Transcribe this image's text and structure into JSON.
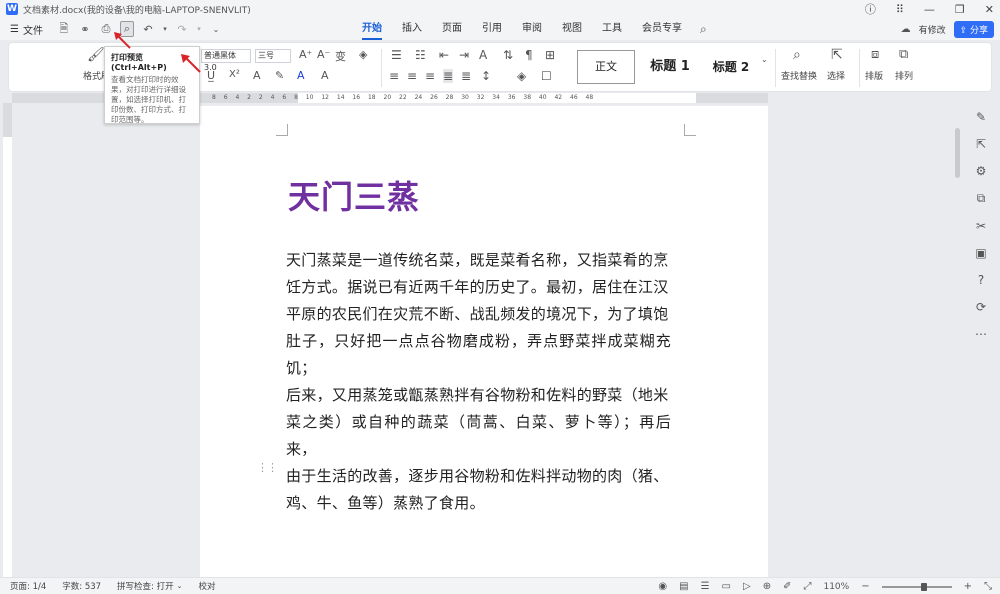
{
  "window": {
    "title": "文档素材.docx(我的设备\\我的电脑-LAPTOP-SNENVLIT)",
    "app_logo": "W"
  },
  "menu": {
    "file_label": "文件",
    "tabs": [
      {
        "label": "开始",
        "active": true
      },
      {
        "label": "插入",
        "active": false
      },
      {
        "label": "页面",
        "active": false
      },
      {
        "label": "引用",
        "active": false
      },
      {
        "label": "审阅",
        "active": false
      },
      {
        "label": "视图",
        "active": false
      },
      {
        "label": "工具",
        "active": false
      },
      {
        "label": "会员专享",
        "active": false
      }
    ],
    "modified_label": "有修改",
    "share_label": "分享"
  },
  "ribbon": {
    "format_painter": "格式刷",
    "font_name": "普通黑体 3.0",
    "font_size": "三号",
    "styles": {
      "normal": "正文",
      "heading1": "标题 1",
      "heading2": "标题 2"
    },
    "find_replace": "查找替换",
    "select": "选择",
    "layout": "排版",
    "arrange": "排列"
  },
  "tooltip": {
    "title": "打印预览 (Ctrl+Alt+P)",
    "description": "查看文档打印时的效果，对打印进行详细设置，如选择打印机、打印份数、打印方式、打印范围等。"
  },
  "ruler": {
    "ticks": "8 6 4 2 2 4 6 8 10 12 14 16 18 20 22 24 26 28 30 32 34 36 38 40 42 46 48"
  },
  "document": {
    "heading": "天门三蒸",
    "paragraph_lines": [
      "天门蒸菜是一道传统名菜，既是菜肴名称，又指菜肴的烹",
      "饪方式。据说已有近两千年的历史了。最初，居住在江汉",
      "平原的农民们在灾荒不断、战乱频发的境况下，为了填饱",
      "肚子，只好把一点点谷物磨成粉，弄点野菜拌成菜糊充饥；",
      "后来，又用蒸笼或甑蒸熟拌有谷物粉和佐料的野菜（地米",
      "菜之类）或自种的蔬菜（茼蒿、白菜、萝卜等）；再后来，",
      "由于生活的改善，逐步用谷物粉和佐料拌动物的肉（猪、",
      "鸡、牛、鱼等）蒸熟了食用。"
    ],
    "heading_color": "#7030a0"
  },
  "status": {
    "page": "页面: 1/4",
    "word_count": "字数: 537",
    "spell_check": "拼写检查: 打开",
    "proofread": "校对",
    "zoom": "110%",
    "zoom_level": 0.6
  },
  "colors": {
    "accent": "#1a5fd8",
    "share": "#2f6df6",
    "arrow": "#d9252a"
  }
}
